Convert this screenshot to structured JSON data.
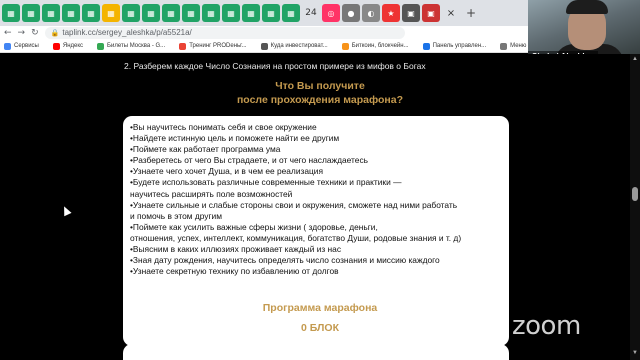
{
  "browser": {
    "tabs": [
      {
        "icon": "green-sheet-icon",
        "color": "#21a366"
      },
      {
        "icon": "green-sheet-icon",
        "color": "#21a366"
      },
      {
        "icon": "green-sheet-icon",
        "color": "#21a366"
      },
      {
        "icon": "green-sheet-icon",
        "color": "#21a366"
      },
      {
        "icon": "green-sheet-icon",
        "color": "#21a366"
      },
      {
        "icon": "yellow-doc-icon",
        "color": "#f4b400"
      },
      {
        "icon": "green-sheet-icon",
        "color": "#21a366"
      },
      {
        "icon": "green-sheet-icon",
        "color": "#21a366"
      },
      {
        "icon": "green-sheet-icon",
        "color": "#21a366"
      },
      {
        "icon": "green-sheet-icon",
        "color": "#21a366"
      },
      {
        "icon": "green-sheet-icon",
        "color": "#21a366"
      },
      {
        "icon": "green-sheet-icon",
        "color": "#21a366"
      },
      {
        "icon": "green-sheet-icon",
        "color": "#21a366"
      },
      {
        "icon": "green-sheet-icon",
        "color": "#21a366"
      },
      {
        "icon": "green-sheet-icon",
        "color": "#21a366"
      }
    ],
    "tab_number": "24",
    "url": "taplink.cc/sergey_aleshka/p/a5521a/",
    "bookmarks": [
      {
        "label": "Сервисы",
        "color": "#4285f4"
      },
      {
        "label": "Яндекс",
        "color": "#ff0000"
      },
      {
        "label": "Билеты Москва - G...",
        "color": "#34a853"
      },
      {
        "label": "Тренинг PRODеньг...",
        "color": "#ea4335"
      },
      {
        "label": "Куда инвестироват...",
        "color": "#555555"
      },
      {
        "label": "Биткоин, блокчейн...",
        "color": "#f7931a"
      },
      {
        "label": "Панель управлен...",
        "color": "#1a73e8"
      },
      {
        "label": "Меню",
        "color": "#777777"
      }
    ]
  },
  "participant": {
    "name": "Siarhei Aleshk..."
  },
  "page": {
    "list_line": "2.  Разберем каждое Число Сознания на простом примере из мифов о Богах",
    "heading_line1": "Что Вы получите",
    "heading_line2": "после прохождения марафона?",
    "benefits": [
      "•Вы научитесь понимать себя и свое окружение",
      "•Найдете истинную цель и поможете найти ее другим",
      "•Поймете как работает программа ума",
      "•Разберетесь от чего Вы страдаете, и от чего наслаждаетесь",
      "•Узнаете чего хочет Душа, и в чем ее реализация",
      "•Будете использовать различные современные техники и практики —",
      "  научитесь расширять поле возможностей",
      "•Узнаете сильные и слабые стороны свои и окружения, сможете над ними работать",
      "  и помочь в этом другим",
      "•Поймете как усилить важные сферы жизни ( здоровье, деньги,",
      "  отношения, успех, интеллект, коммуникация, богатство Души, родовые знания и т. д)",
      "•Выясним в каких иллюзиях проживает каждый из нас",
      "•Зная дату рождения, научитесь определять число сознания и миссию каждого",
      "•Узнаете секретную технику по избавлению от долгов"
    ],
    "program_heading": "Программа марафона",
    "block_heading": "0 БЛОК"
  },
  "zoom_logo": "zoom",
  "colors": {
    "accent_gold": "#c49a4f",
    "background": "#000000",
    "card": "#ffffff"
  }
}
